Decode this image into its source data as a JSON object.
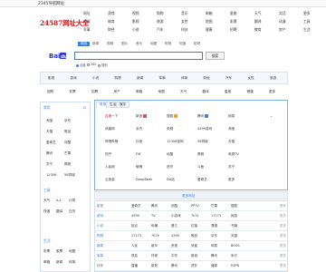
{
  "topbar": {
    "url": "2345导航",
    "right": "网址"
  },
  "brand": {
    "title": "24587网址大全"
  },
  "nav_cols": [
    [
      "网址",
      "新闻",
      "军事"
    ],
    [
      "游戏",
      "体育",
      "财经"
    ],
    [
      "视频",
      "影视",
      "小说"
    ],
    [
      "购物",
      "旅游",
      "汽车"
    ],
    [
      "音乐",
      "女性",
      "科技"
    ],
    [
      "邮箱",
      "地图",
      "健康"
    ],
    [
      "星座",
      "彩票",
      "招聘"
    ],
    [
      "天气",
      "翻译",
      "教育"
    ],
    [
      "笑话",
      "动漫",
      "房产"
    ],
    [
      "更多",
      "工具",
      "生活"
    ]
  ],
  "search": {
    "tabs": [
      "网页",
      "新闻",
      "视频",
      "图片",
      "音乐",
      "地图",
      "购物",
      "知道",
      "贴吧"
    ],
    "active_tab": 0,
    "placeholder": "",
    "button": "搜索",
    "options": [
      "百度",
      "360",
      "搜狗"
    ],
    "selected_option": 0
  },
  "categories_row1": [
    "影视",
    "游戏",
    "小说",
    "购物",
    "新闻",
    "军事",
    "体育",
    "财经",
    "汽车",
    "女性",
    "旅游"
  ],
  "categories_row2": [
    "团购",
    "彩票",
    "招聘",
    "房产",
    "邮箱",
    "地图",
    "天气",
    "翻译",
    "星座",
    "健康",
    "更多"
  ],
  "sidebar": {
    "head1": "常用",
    "items1": [
      "淘宝",
      "京东",
      "天猫",
      "唯品",
      "爱奇艺",
      "优酷",
      "腾讯",
      "芒果",
      "苏宁",
      "携程",
      "12306",
      "58同城"
    ],
    "head2": "工具",
    "items2": [
      "天气",
      "A-1",
      "计算",
      "快递",
      "翻译",
      "日历"
    ],
    "head3": "生活",
    "items3": [
      "彩票",
      "股票",
      "地图",
      "邮箱",
      "新闻",
      "体育"
    ]
  },
  "site_tabs": [
    "常用",
    "生活",
    "娱乐"
  ],
  "active_site_tab": 0,
  "sites": [
    [
      "百度一下",
      "新浪",
      "搜狐",
      "腾讯",
      "网易"
    ],
    [
      "凤凰网",
      "京东",
      "央视",
      "4399游戏",
      "淘宝"
    ],
    [
      "哔哩哔哩",
      "抖音",
      "12306官网",
      "58同城",
      "天猫"
    ],
    [
      "知乎",
      "FM",
      "优酷",
      "携程",
      "电视TV"
    ],
    [
      "人民网",
      "微博",
      "虎牙",
      "斗鱼",
      "苏宁"
    ],
    [
      "云旅游",
      "DeepSeek",
      "DA站",
      "爱奇艺",
      "更多"
    ]
  ],
  "section_title": "更多网址",
  "table": [
    [
      "影视",
      "爱奇艺",
      "腾讯",
      "优酷",
      "PPTV",
      "芒果",
      "搜狐",
      "更多"
    ],
    [
      "游戏",
      "4399",
      "TV",
      "小游戏",
      "7k7k",
      "17173",
      "网游",
      "更多"
    ],
    [
      "小说",
      "起点",
      "纵横",
      "晋江",
      "红袖",
      "潇湘",
      "书旗",
      "更多"
    ],
    [
      "购物",
      "17173",
      "7K7k",
      "4399",
      "唯品",
      "京东",
      "天猫",
      "更多"
    ],
    [
      "新闻",
      "人民",
      "新华",
      "央视",
      "凤凰",
      "网易",
      "BOSS",
      "更多"
    ],
    [
      "军事",
      "铁血",
      "环球",
      "中华",
      "新浪",
      "腾讯",
      "米尔",
      "更多"
    ],
    [
      "体育",
      "直播",
      "新浪",
      "腾讯",
      "虎扑",
      "懂球",
      "ESPN",
      "更多"
    ]
  ],
  "colors": {
    "accent": "#3a7ddf",
    "brand_red": "#d0171d"
  }
}
